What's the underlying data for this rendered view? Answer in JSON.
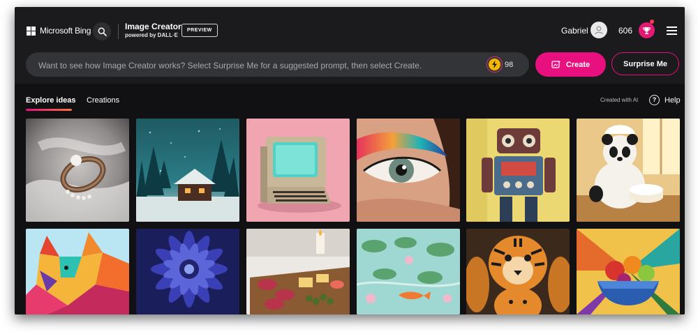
{
  "header": {
    "brand": "Microsoft Bing",
    "app_title": "Image Creator",
    "app_subtitle": "powered by DALL·E",
    "badge": "PREVIEW",
    "user_name": "Gabriel",
    "points": "606"
  },
  "prompt": {
    "placeholder": "Want to see how Image Creator works? Select Surprise Me for a suggested prompt, then select Create.",
    "boosts": "98",
    "create_label": "Create",
    "surprise_label": "Surprise Me"
  },
  "tabs": [
    {
      "label": "Explore ideas",
      "active": true
    },
    {
      "label": "Creations",
      "active": false
    }
  ],
  "meta": {
    "created_with_ai": "Created with AI",
    "help_label": "Help"
  },
  "gallery": [
    {
      "subject": "pearl-ring"
    },
    {
      "subject": "snowy-cabin"
    },
    {
      "subject": "retro-computer"
    },
    {
      "subject": "eye-makeup"
    },
    {
      "subject": "robot"
    },
    {
      "subject": "panda-baker"
    },
    {
      "subject": "geometric-wolf"
    },
    {
      "subject": "blue-flower"
    },
    {
      "subject": "charcuterie"
    },
    {
      "subject": "koi-pond"
    },
    {
      "subject": "tigers"
    },
    {
      "subject": "fruit-bowl"
    }
  ],
  "colors": {
    "accent": "#e8107e",
    "background": "#1b1b1d",
    "gallery_background": "#111113"
  }
}
